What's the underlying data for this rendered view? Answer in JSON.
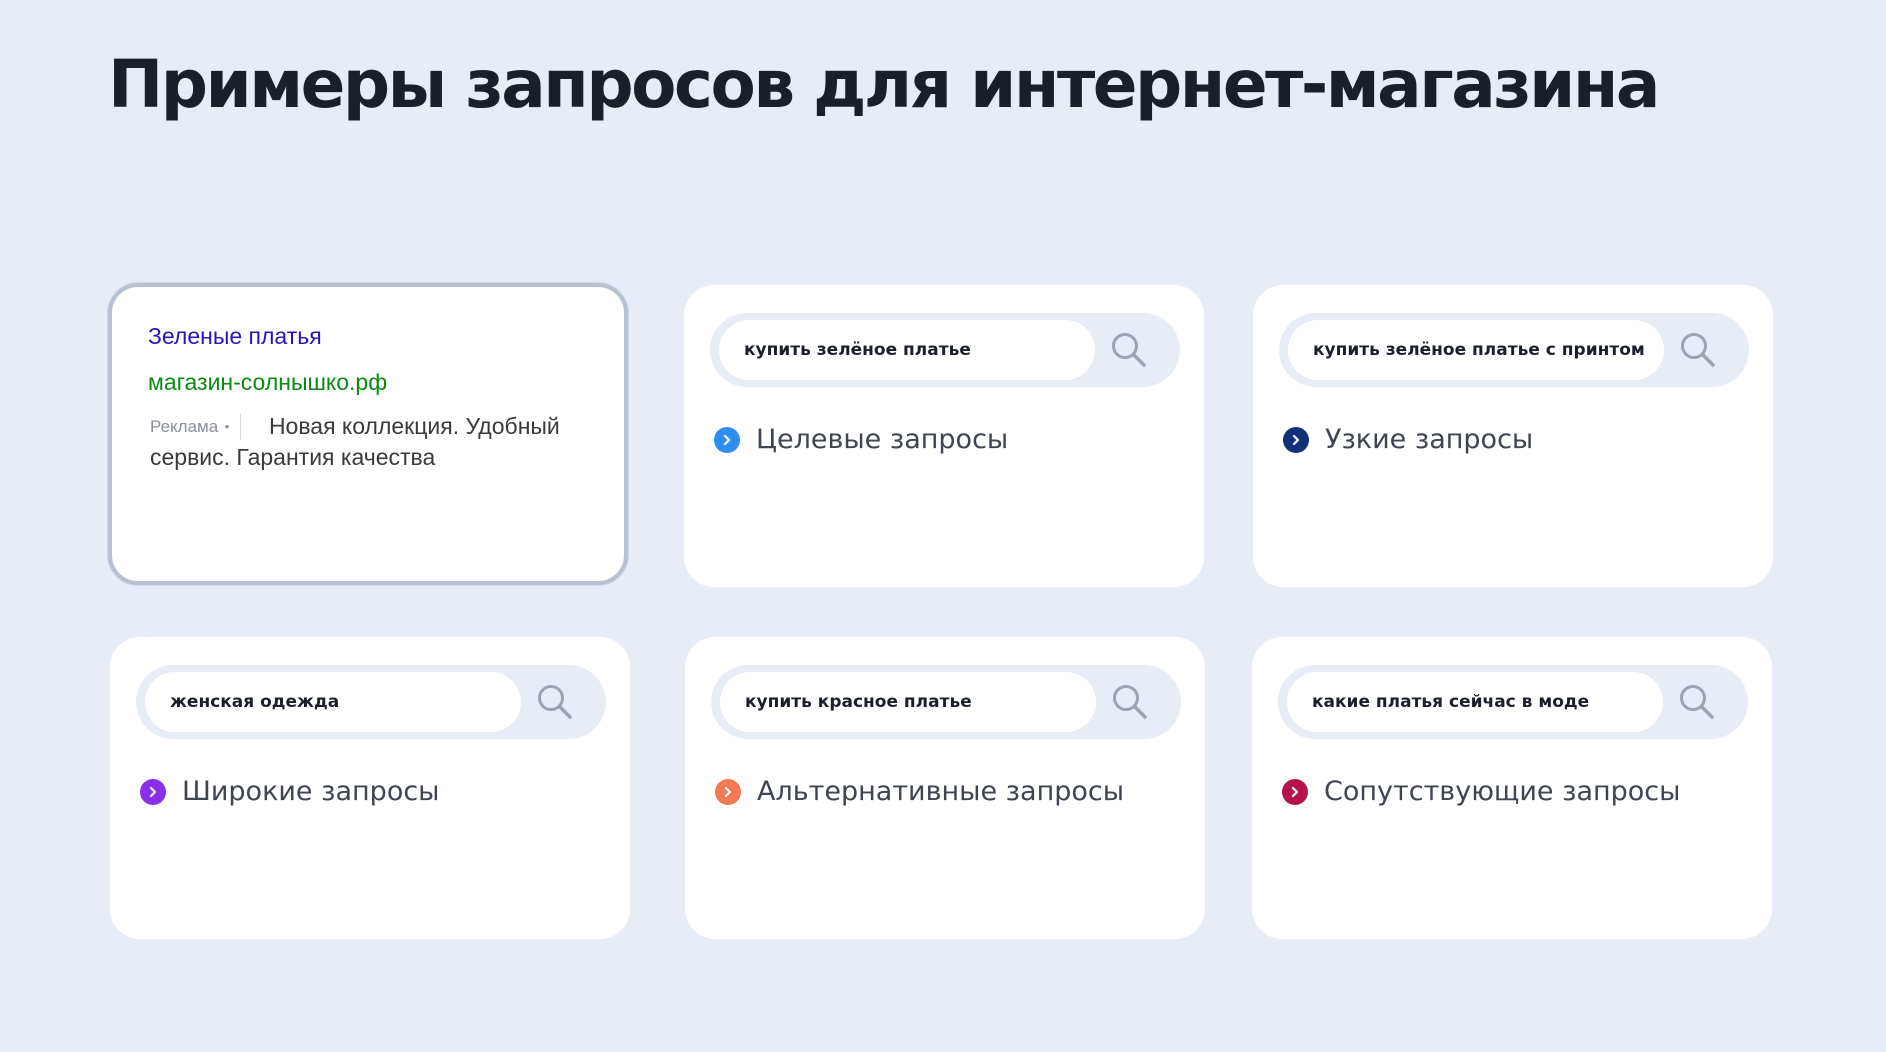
{
  "page_title": "Примеры запросов для интернет-магазина",
  "ad": {
    "title": "Зеленые платья",
    "url": "магазин-солнышко.рф",
    "badge": "Реклама",
    "badge_dot": "•",
    "description": "Новая коллекция. Удобный сервис. Гарантия качества"
  },
  "cards": [
    {
      "query": "купить зелёное платье",
      "label": "Целевые запросы",
      "bullet_color": "#2f8cf0",
      "icon": "chevron-right-icon"
    },
    {
      "query": "купить зелёное платье с принтом",
      "label": "Узкие запросы",
      "bullet_color": "#13307a",
      "icon": "chevron-right-icon"
    },
    {
      "query": "женская одежда",
      "label": "Широкие запросы",
      "bullet_color": "#8b2fe8",
      "icon": "chevron-right-icon"
    },
    {
      "query": "купить красное платье",
      "label": "Альтернативные запросы",
      "bullet_color": "#f27a53",
      "icon": "chevron-right-icon"
    },
    {
      "query": "какие платья сейчас в моде",
      "label": "Сопутствующие запросы",
      "bullet_color": "#b5114f",
      "icon": "chevron-right-icon"
    }
  ],
  "search_icon": "search-icon"
}
